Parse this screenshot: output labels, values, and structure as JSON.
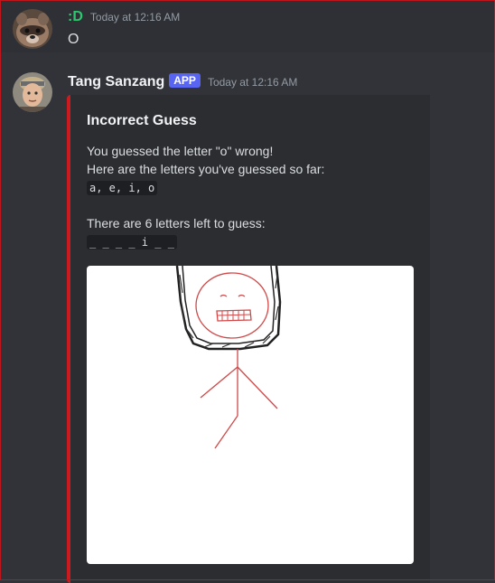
{
  "messages": [
    {
      "username": ":D",
      "timestamp": "Today at 12:16 AM",
      "text": "O"
    },
    {
      "username": "Tang Sanzang",
      "badge": "APP",
      "timestamp": "Today at 12:16 AM",
      "embed": {
        "accent_color": "#cc1a1f",
        "title": "Incorrect Guess",
        "line1": "You guessed the letter \"o\" wrong!",
        "line2": "Here are the letters you've guessed so far:",
        "guessed_letters": "a, e, i, o",
        "line3": "There are 6 letters left to guess:",
        "word_progress": "_ _ _ _ i _ _"
      }
    }
  ],
  "colors": {
    "background": "#313338",
    "username_green": "#2dc770",
    "app_badge": "#5865f2"
  },
  "icons": {
    "avatar1": "raccoon-avatar-icon",
    "avatar2": "man-avatar-icon"
  }
}
